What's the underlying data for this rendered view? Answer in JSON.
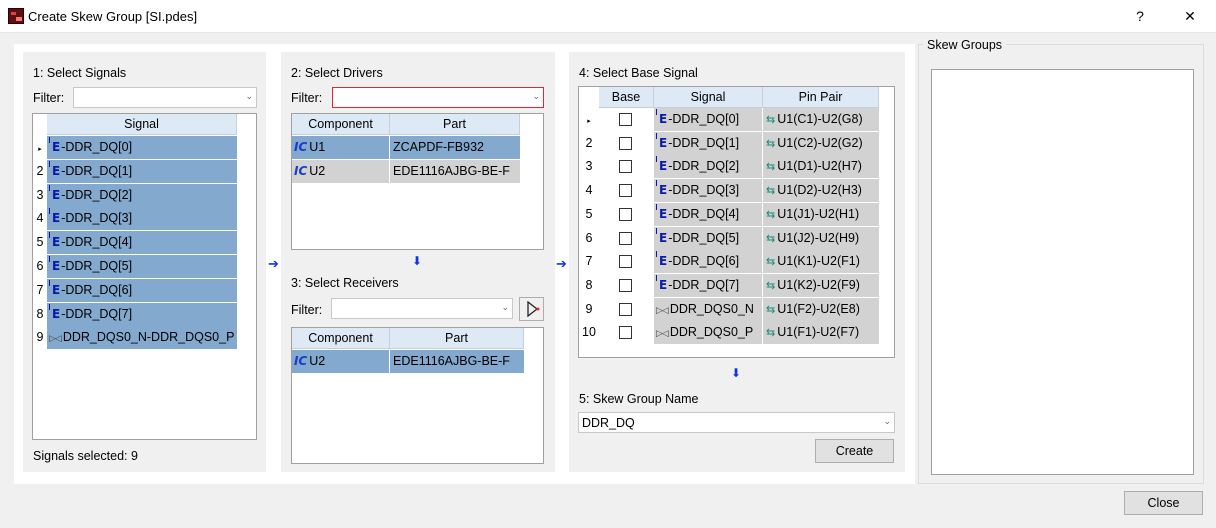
{
  "window": {
    "title": "Create Skew Group [SI.pdes]",
    "help": "?",
    "close": "✕"
  },
  "step1": {
    "label": "1:  Select Signals",
    "filter_label": "Filter:",
    "filter_value": "",
    "header": "Signal",
    "rows": [
      {
        "num": "▸",
        "type": "E",
        "name": "DDR_DQ[0]"
      },
      {
        "num": "2",
        "type": "E",
        "name": "DDR_DQ[1]"
      },
      {
        "num": "3",
        "type": "E",
        "name": "DDR_DQ[2]"
      },
      {
        "num": "4",
        "type": "E",
        "name": "DDR_DQ[3]"
      },
      {
        "num": "5",
        "type": "E",
        "name": "DDR_DQ[4]"
      },
      {
        "num": "6",
        "type": "E",
        "name": "DDR_DQ[5]"
      },
      {
        "num": "7",
        "type": "E",
        "name": "DDR_DQ[6]"
      },
      {
        "num": "8",
        "type": "E",
        "name": "DDR_DQ[7]"
      },
      {
        "num": "9",
        "type": "D",
        "name": "DDR_DQS0_N-DDR_DQS0_P"
      }
    ],
    "status": "Signals selected: 9"
  },
  "step2": {
    "label": "2:  Select Drivers",
    "filter_label": "Filter:",
    "filter_value": "",
    "headers": [
      "Component",
      "Part"
    ],
    "rows": [
      {
        "component": "U1",
        "part": "ZCAPDF-FB932",
        "selected": true
      },
      {
        "component": "U2",
        "part": "EDE1116AJBG-BE-F",
        "selected": false
      }
    ]
  },
  "step3": {
    "label": "3:  Select Receivers",
    "filter_label": "Filter:",
    "filter_value": "",
    "headers": [
      "Component",
      "Part"
    ],
    "rows": [
      {
        "component": "U2",
        "part": "EDE1116AJBG-BE-F",
        "selected": true
      }
    ]
  },
  "step4": {
    "label": "4:  Select Base Signal",
    "headers": [
      "Base",
      "Signal",
      "Pin Pair"
    ],
    "rows": [
      {
        "num": "▸",
        "type": "E",
        "signal": "DDR_DQ[0]",
        "pinpair": "U1(C1)-U2(G8)",
        "base": false
      },
      {
        "num": "2",
        "type": "E",
        "signal": "DDR_DQ[1]",
        "pinpair": "U1(C2)-U2(G2)",
        "base": false
      },
      {
        "num": "3",
        "type": "E",
        "signal": "DDR_DQ[2]",
        "pinpair": "U1(D1)-U2(H7)",
        "base": false
      },
      {
        "num": "4",
        "type": "E",
        "signal": "DDR_DQ[3]",
        "pinpair": "U1(D2)-U2(H3)",
        "base": false
      },
      {
        "num": "5",
        "type": "E",
        "signal": "DDR_DQ[4]",
        "pinpair": "U1(J1)-U2(H1)",
        "base": false
      },
      {
        "num": "6",
        "type": "E",
        "signal": "DDR_DQ[5]",
        "pinpair": "U1(J2)-U2(H9)",
        "base": false
      },
      {
        "num": "7",
        "type": "E",
        "signal": "DDR_DQ[6]",
        "pinpair": "U1(K1)-U2(F1)",
        "base": false
      },
      {
        "num": "8",
        "type": "E",
        "signal": "DDR_DQ[7]",
        "pinpair": "U1(K2)-U2(F9)",
        "base": false
      },
      {
        "num": "9",
        "type": "D",
        "signal": "DDR_DQS0_N",
        "pinpair": "U1(F2)-U2(E8)",
        "base": false
      },
      {
        "num": "10",
        "type": "D",
        "signal": "DDR_DQS0_P",
        "pinpair": "U1(F1)-U2(F7)",
        "base": false
      }
    ]
  },
  "step5": {
    "label": "5: Skew Group Name",
    "name_value": "DDR_DQ",
    "create_label": "Create"
  },
  "skew_groups": {
    "label": "Skew Groups"
  },
  "footer": {
    "close_label": "Close"
  }
}
